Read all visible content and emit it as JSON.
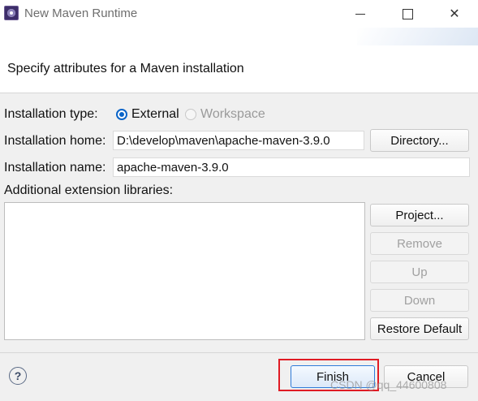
{
  "window": {
    "title": "New Maven Runtime",
    "minimize_glyph": "",
    "maximize_glyph": "",
    "close_glyph": "✕"
  },
  "header": {
    "message": "Specify attributes for a Maven installation"
  },
  "form": {
    "installation_type_label": "Installation type:",
    "type_options": [
      {
        "label": "External",
        "selected": true,
        "enabled": true
      },
      {
        "label": "Workspace",
        "selected": false,
        "enabled": false
      }
    ],
    "installation_home_label": "Installation home:",
    "installation_home_value": "D:\\develop\\maven\\apache-maven-3.9.0",
    "installation_name_label": "Installation name:",
    "installation_name_value": "apache-maven-3.9.0",
    "extension_libraries_label": "Additional extension libraries:",
    "extension_libraries": []
  },
  "buttons": {
    "directory": "Directory...",
    "project": "Project...",
    "remove": "Remove",
    "up": "Up",
    "down": "Down",
    "restore_default": "Restore Default",
    "finish": "Finish",
    "cancel": "Cancel"
  },
  "footer": {
    "help_glyph": "?"
  },
  "watermark": "CSDN @qq_44600808",
  "colors": {
    "accent": "#0a64c8",
    "highlight": "#e01b24"
  }
}
